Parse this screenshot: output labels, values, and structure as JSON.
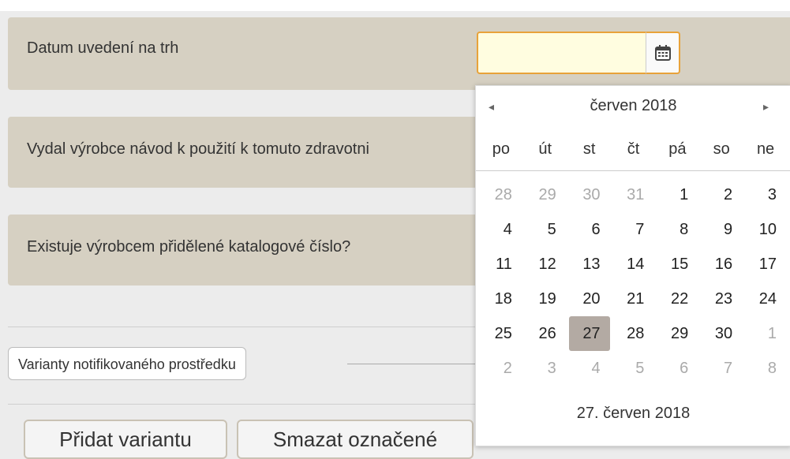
{
  "form": {
    "release_date_label": "Datum uvedení na trh",
    "manual_label": "Vydal výrobce návod k použití k tomuto zdravotni",
    "catalog_label": "Existuje výrobcem přidělené katalogové číslo?",
    "release_date_value": "",
    "variants_legend": "Varianty notifikovaného prostředku",
    "add_variant_label": "Přidat variantu",
    "delete_selected_label": "Smazat označené"
  },
  "calendar": {
    "prev_icon": "◂",
    "next_icon": "▸",
    "month_label": "červen 2018",
    "weekdays": [
      "po",
      "út",
      "st",
      "čt",
      "pá",
      "so",
      "ne"
    ],
    "days": [
      {
        "d": "28",
        "other": true
      },
      {
        "d": "29",
        "other": true
      },
      {
        "d": "30",
        "other": true
      },
      {
        "d": "31",
        "other": true
      },
      {
        "d": "1"
      },
      {
        "d": "2"
      },
      {
        "d": "3"
      },
      {
        "d": "4"
      },
      {
        "d": "5"
      },
      {
        "d": "6"
      },
      {
        "d": "7"
      },
      {
        "d": "8"
      },
      {
        "d": "9"
      },
      {
        "d": "10"
      },
      {
        "d": "11"
      },
      {
        "d": "12"
      },
      {
        "d": "13"
      },
      {
        "d": "14"
      },
      {
        "d": "15"
      },
      {
        "d": "16"
      },
      {
        "d": "17"
      },
      {
        "d": "18"
      },
      {
        "d": "19"
      },
      {
        "d": "20"
      },
      {
        "d": "21"
      },
      {
        "d": "22"
      },
      {
        "d": "23"
      },
      {
        "d": "24"
      },
      {
        "d": "25"
      },
      {
        "d": "26"
      },
      {
        "d": "27",
        "selected": true
      },
      {
        "d": "28"
      },
      {
        "d": "29"
      },
      {
        "d": "30"
      },
      {
        "d": "1",
        "other": true
      },
      {
        "d": "2",
        "other": true
      },
      {
        "d": "3",
        "other": true
      },
      {
        "d": "4",
        "other": true
      },
      {
        "d": "5",
        "other": true
      },
      {
        "d": "6",
        "other": true
      },
      {
        "d": "7",
        "other": true
      },
      {
        "d": "8",
        "other": true
      }
    ],
    "today_label": "27. červen 2018"
  },
  "colors": {
    "row_bg": "#d6d0c2",
    "input_bg": "#fffde0",
    "focus_border": "#e8a23a",
    "selected_day": "#b3aaa3"
  },
  "icons": {
    "calendar_button": "calendar-icon"
  }
}
